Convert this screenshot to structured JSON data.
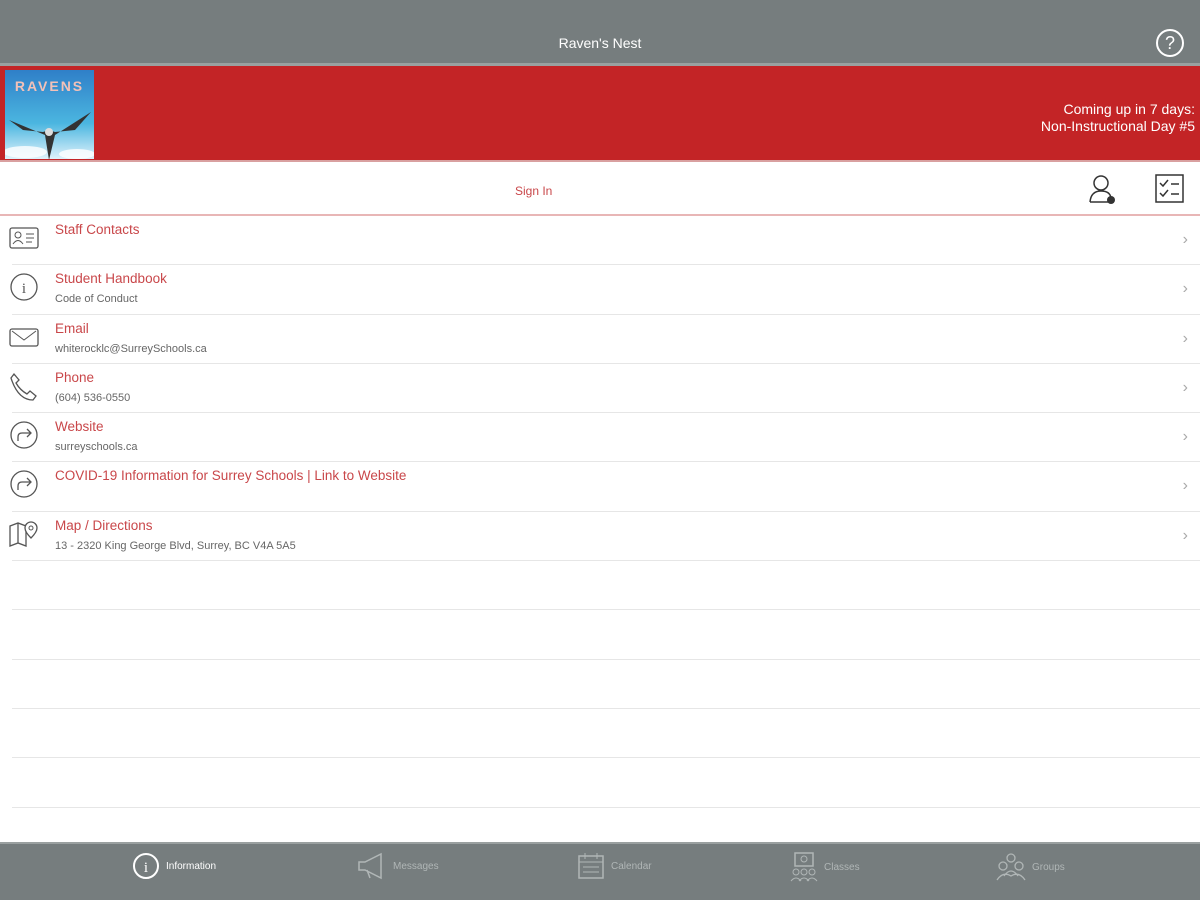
{
  "header": {
    "title": "Raven's Nest",
    "help_icon": "?"
  },
  "banner": {
    "logo_text": "RAVENS",
    "upcoming_line1": "Coming up in 7 days:",
    "upcoming_line2": "Non-Instructional Day #5"
  },
  "signin": {
    "label": "Sign In"
  },
  "items": [
    {
      "label": "Staff Contacts",
      "sub": "",
      "icon": "contact-card"
    },
    {
      "label": "Student Handbook",
      "sub": "Code of Conduct",
      "icon": "info"
    },
    {
      "label": "Email",
      "sub": "whiterocklc@SurreySchools.ca",
      "icon": "envelope"
    },
    {
      "label": "Phone",
      "sub": "(604) 536-0550",
      "icon": "phone"
    },
    {
      "label": "Website",
      "sub": "surreyschools.ca",
      "icon": "share-arrow"
    },
    {
      "label": "COVID-19 Information for Surrey Schools | Link to Website",
      "sub": "",
      "icon": "share-arrow"
    },
    {
      "label": "Map / Directions",
      "sub": "13 - 2320 King George Blvd, Surrey, BC V4A 5A5",
      "icon": "map-pin"
    }
  ],
  "tabs": [
    {
      "label": "Information"
    },
    {
      "label": "Messages"
    },
    {
      "label": "Calendar"
    },
    {
      "label": "Classes"
    },
    {
      "label": "Groups"
    }
  ],
  "colors": {
    "accent": "#c32426",
    "bar": "#767d7e"
  }
}
